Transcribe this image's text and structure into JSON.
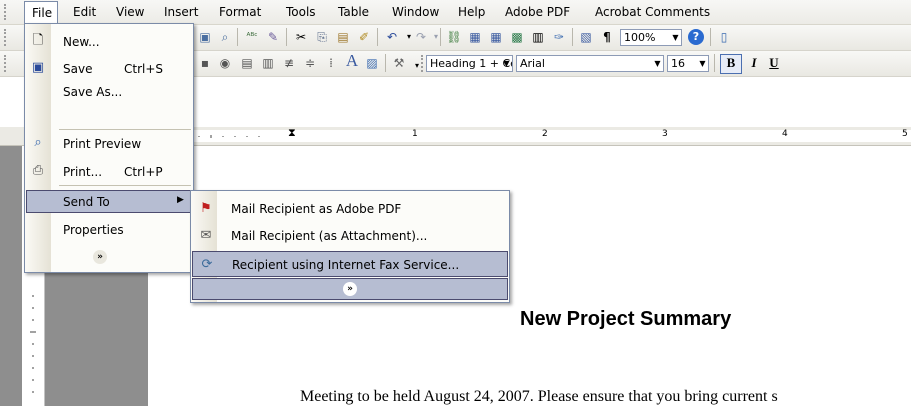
{
  "menubar": {
    "items": [
      {
        "label": "File"
      },
      {
        "label": "Edit"
      },
      {
        "label": "View"
      },
      {
        "label": "Insert"
      },
      {
        "label": "Format"
      },
      {
        "label": "Tools"
      },
      {
        "label": "Table"
      },
      {
        "label": "Window"
      },
      {
        "label": "Help"
      },
      {
        "label": "Adobe PDF"
      },
      {
        "label": "Acrobat Comments"
      }
    ]
  },
  "toolbar": {
    "zoom": "100%",
    "style": "Heading 1 + Ce",
    "font": "Arial",
    "size": "16",
    "bold_label": "B",
    "italic_label": "I",
    "underline_label": "U",
    "pilcrow": "¶",
    "font_a": "A"
  },
  "ruler": {
    "ticks": [
      "1",
      "2",
      "3",
      "4",
      "5"
    ]
  },
  "file_menu": {
    "items": [
      {
        "label": "New...",
        "shortcut": ""
      },
      {
        "label": "Save",
        "shortcut": "Ctrl+S"
      },
      {
        "label": "Save As...",
        "shortcut": ""
      },
      {
        "label": "Print Preview",
        "shortcut": ""
      },
      {
        "label": "Print...",
        "shortcut": "Ctrl+P"
      },
      {
        "label": "Send To",
        "shortcut": ""
      },
      {
        "label": "Properties",
        "shortcut": ""
      }
    ],
    "expand": "»"
  },
  "send_to_menu": {
    "items": [
      {
        "label": "Mail Recipient as Adobe PDF"
      },
      {
        "label": "Mail Recipient (as Attachment)..."
      },
      {
        "label": "Recipient using Internet Fax Service..."
      }
    ],
    "expand": "»"
  },
  "document": {
    "title": "New Project Summary",
    "body_line": "Meeting to be held August 24, 2007.  Please ensure that you bring current s"
  },
  "colors": {
    "menu_highlight": "#b6bdd2",
    "menu_border": "#7b8ba8",
    "doc_background": "#8e8e8e"
  }
}
